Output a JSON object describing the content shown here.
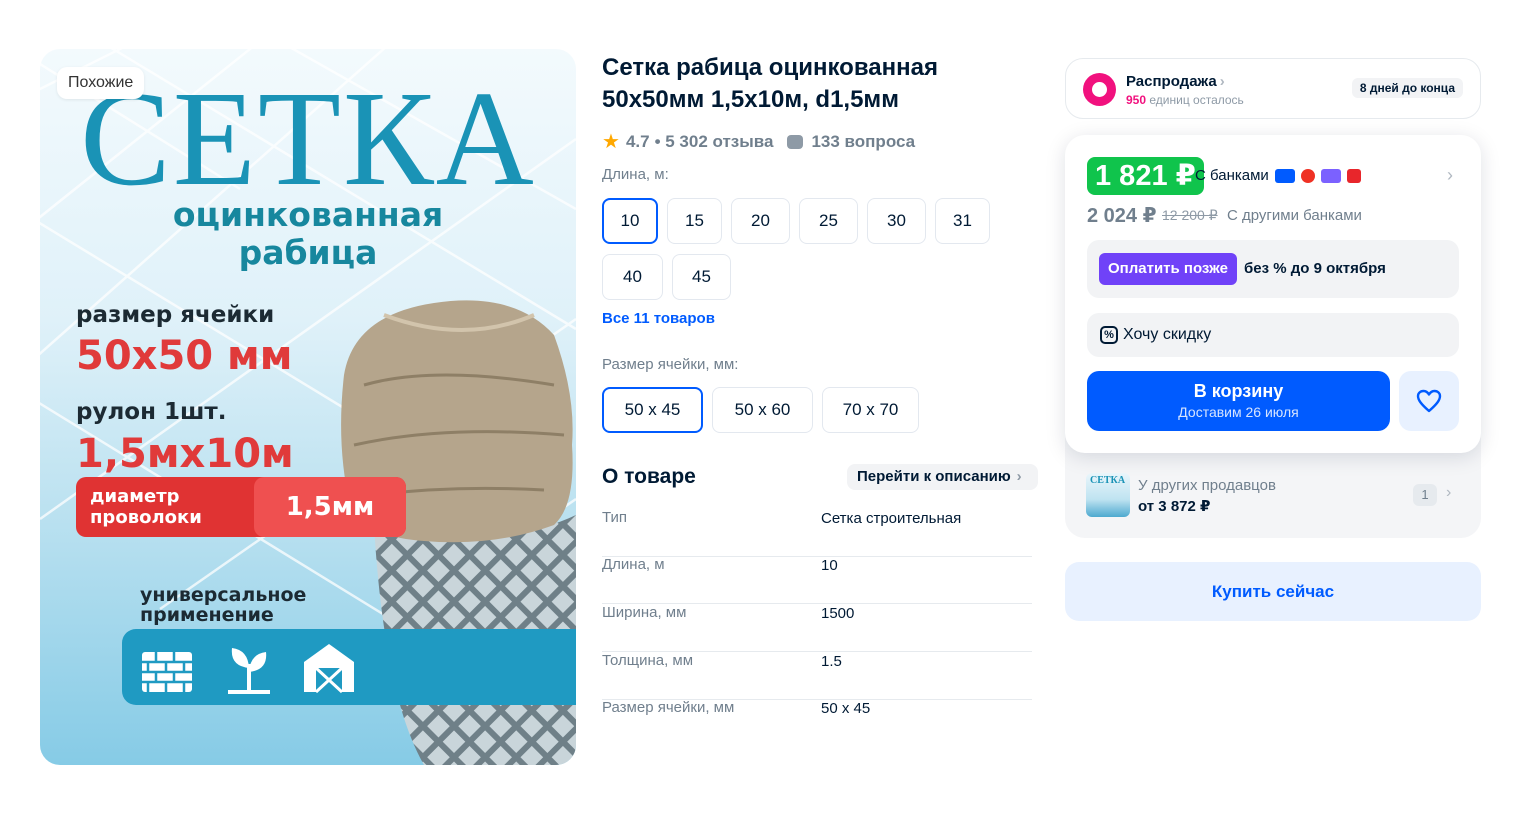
{
  "gallery": {
    "similar_label": "Похожие",
    "title": "СЕТКА",
    "subtitle_line1": "оцинкованная",
    "subtitle_line2": "рабица",
    "cell_label": "размер ячейки",
    "cell_value": "50х50 мм",
    "roll_label": "рулон 1шт.",
    "roll_value": "1,5мх10м",
    "diameter_label": "диаметр проволоки",
    "diameter_value": "1,5мм",
    "universal_line1": "универсальное",
    "universal_line2": "применение",
    "usage_icons": [
      "brick-wall-icon",
      "garden-plant-icon",
      "barn-icon"
    ]
  },
  "product": {
    "title": "Сетка рабица оцинкованная 50х50мм 1,5х10м, d1,5мм",
    "rating": "4.7",
    "reviews": "• 5 302 отзыва",
    "questions": "133 вопроса"
  },
  "options": {
    "length_label": "Длина, м:",
    "lengths": [
      "10",
      "15",
      "20",
      "25",
      "30",
      "31",
      "40",
      "45"
    ],
    "all_link": "Все 11 товаров",
    "cell_label": "Размер ячейки, мм:",
    "cells": [
      "50 х 45",
      "50 х 60",
      "70 х 70"
    ]
  },
  "about": {
    "heading": "О товаре",
    "link": "Перейти к описанию",
    "specs": [
      {
        "key": "Тип",
        "value": "Сетка строительная"
      },
      {
        "key": "Длина, м",
        "value": "10"
      },
      {
        "key": "Ширина, мм",
        "value": "1500"
      },
      {
        "key": "Толщина, мм",
        "value": "1.5"
      },
      {
        "key": "Размер ячейки, мм",
        "value": "50 x 45"
      }
    ]
  },
  "sale": {
    "title": "Распродажа",
    "count": "950",
    "count_suffix": "единиц осталось",
    "days": "8 дней до конца"
  },
  "pricing": {
    "card_price": "1 821 ₽",
    "card_banks": "С банками",
    "bank_logos": [
      "ozon-bank-logo",
      "bank-logo-2",
      "bank-logo-3",
      "bank-logo-4"
    ],
    "other_price": "2 024 ₽",
    "old_price": "12 200 ₽",
    "other_banks": "С другими банками",
    "pay_later_btn": "Оплатить позже",
    "pay_later_text": "без % до 9 октября",
    "discount": "Хочу скидку",
    "cart_title": "В корзину",
    "cart_sub": "Доставим 26 июля"
  },
  "sellers": {
    "label": "У других продавцов",
    "price": "от 3 872 ₽",
    "count": "1",
    "thumb_text": "СЕТКА"
  },
  "buy_now": "Купить сейчас",
  "colors": {
    "accent": "#005bff",
    "price_green": "#10c44c",
    "sale_pink": "#f1117e",
    "pay_later_purple": "#7042f8",
    "promo_red": "#e03a3a",
    "promo_blue": "#1a93b6"
  }
}
